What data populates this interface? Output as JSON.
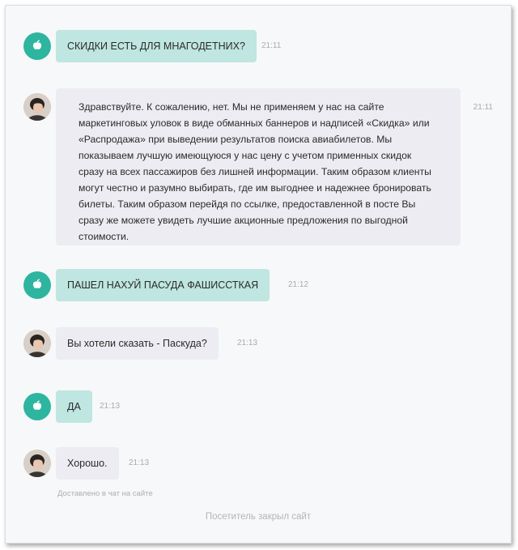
{
  "messages": [
    {
      "from": "visitor",
      "text": "СКИДКИ ЕСТЬ ДЛЯ МНАГОДЕТНИХ?",
      "time": "21:11"
    },
    {
      "from": "agent",
      "text": "Здравствуйте. К сожалению, нет. Мы не применяем у нас на сайте маркетинговых уловок в виде обманных баннеров и надписей «Скидка» или «Распродажа» при выведении результатов поиска авиабилетов. Мы показываем лучшую имеющуюся у нас цену с учетом применных скидок сразу на всех пассажиров без лишней информации. Таким образом клиенты могут честно и разумно выбирать, где им выгоднее и надежнее бронировать билеты. Таким образом перейдя по ссылке, предоставленной в посте Вы сразу же можете увидеть лучшие акционные предложения по выгодной стоимости.",
      "time": "21:11"
    },
    {
      "from": "visitor",
      "text": "ПАШЕЛ НАХУЙ ПАСУДА ФАШИССТКАЯ",
      "time": "21:12"
    },
    {
      "from": "agent",
      "text": "Вы хотели сказать - Паскуда?",
      "time": "21:13"
    },
    {
      "from": "visitor",
      "text": "ДА",
      "time": "21:13"
    },
    {
      "from": "agent",
      "text": "Хорошо.",
      "time": "21:13"
    }
  ],
  "status": {
    "delivered": "Доставлено в чат на сайте",
    "closed": "Посетитель закрыл сайт"
  },
  "colors": {
    "visitor_bubble": "#bfe6e0",
    "agent_bubble": "#ececf2",
    "visitor_avatar": "#2db5a0"
  },
  "icons": {
    "visitor_avatar": "apple-icon",
    "agent_avatar": "agent-photo-avatar"
  }
}
